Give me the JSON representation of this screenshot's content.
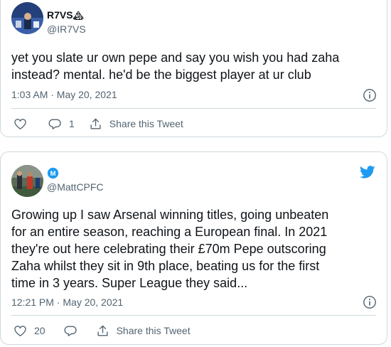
{
  "tweets": [
    {
      "display_name": "R7VS",
      "name_glyph": "🏔",
      "handle": "@IR7VS",
      "text": "yet you slate ur own pepe and say you wish you had zaha\ninstead? mental. he'd be the biggest player at ur club",
      "timestamp": "1:03 AM · May 20, 2021",
      "reply_count": "1",
      "share_label": "Share this Tweet",
      "icons": [
        "heart-icon",
        "reply-icon",
        "share-icon",
        "info-icon"
      ]
    },
    {
      "display_name": "M",
      "handle": "@MattCPFC",
      "text": "Growing up I saw Arsenal winning titles, going unbeaten\nfor an entire season, reaching a European final. In 2021\nthey're out here celebrating their £70m Pepe outscoring\nZaha whilst they sit in 9th place, beating us for the first\ntime in 3 years. Super League they said...",
      "timestamp": "12:21 PM · May 20, 2021",
      "like_count": "20",
      "share_label": "Share this Tweet",
      "icons": [
        "heart-icon",
        "reply-icon",
        "share-icon",
        "info-icon",
        "twitter-bird-icon"
      ]
    }
  ],
  "colors": {
    "text": "#0f1419",
    "muted": "#536471",
    "border": "#cfd9de",
    "twitter_blue": "#1d9bf0"
  }
}
